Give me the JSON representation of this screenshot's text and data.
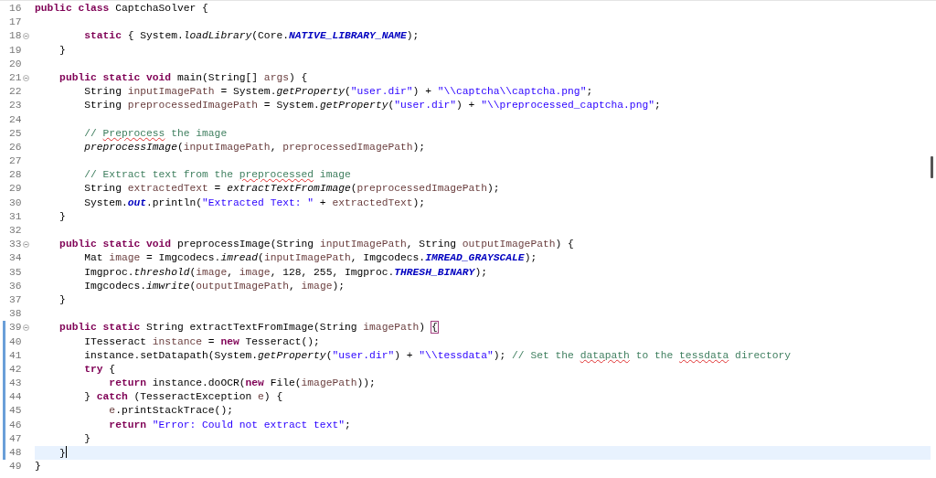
{
  "editor": {
    "lines": [
      {
        "number": "16",
        "tokens": [
          {
            "kind": "keyword",
            "text": "public class "
          },
          {
            "kind": "plain",
            "text": "CaptchaSolver {"
          }
        ]
      },
      {
        "number": "17"
      },
      {
        "number": "18",
        "fold": true,
        "tokens": [
          {
            "kind": "keyword",
            "text": "        static "
          },
          {
            "kind": "plain",
            "text": "{ System."
          },
          {
            "kind": "static-method",
            "text": "loadLibrary"
          },
          {
            "kind": "plain",
            "text": "(Core."
          },
          {
            "kind": "constant",
            "text": "NATIVE_LIBRARY_NAME"
          },
          {
            "kind": "plain",
            "text": ");"
          }
        ]
      },
      {
        "number": "19",
        "tokens": [
          {
            "kind": "plain",
            "text": "    }"
          }
        ]
      },
      {
        "number": "20"
      },
      {
        "number": "21",
        "fold": true,
        "tokens": [
          {
            "kind": "keyword",
            "text": "    public static void "
          },
          {
            "kind": "plain",
            "text": "main(String[] "
          },
          {
            "kind": "variable",
            "text": "args"
          },
          {
            "kind": "plain",
            "text": ") {"
          }
        ]
      },
      {
        "number": "22",
        "tokens": [
          {
            "kind": "plain",
            "text": "        String "
          },
          {
            "kind": "variable",
            "text": "inputImagePath"
          },
          {
            "kind": "plain",
            "text": " = System."
          },
          {
            "kind": "static-method",
            "text": "getProperty"
          },
          {
            "kind": "plain",
            "text": "("
          },
          {
            "kind": "string",
            "text": "\"user.dir\""
          },
          {
            "kind": "plain",
            "text": ") + "
          },
          {
            "kind": "string",
            "text": "\"\\\\captcha\\\\captcha.png\""
          },
          {
            "kind": "plain",
            "text": ";"
          }
        ]
      },
      {
        "number": "23",
        "tokens": [
          {
            "kind": "plain",
            "text": "        String "
          },
          {
            "kind": "variable",
            "text": "preprocessedImagePath"
          },
          {
            "kind": "plain",
            "text": " = System."
          },
          {
            "kind": "static-method",
            "text": "getProperty"
          },
          {
            "kind": "plain",
            "text": "("
          },
          {
            "kind": "string",
            "text": "\"user.dir\""
          },
          {
            "kind": "plain",
            "text": ") + "
          },
          {
            "kind": "string",
            "text": "\"\\\\preprocessed_captcha.png\""
          },
          {
            "kind": "plain",
            "text": ";"
          }
        ]
      },
      {
        "number": "24"
      },
      {
        "number": "25",
        "tokens": [
          {
            "kind": "comment",
            "text": "        // "
          },
          {
            "kind": "misspelled",
            "text": "Preprocess"
          },
          {
            "kind": "comment",
            "text": " the image"
          }
        ]
      },
      {
        "number": "26",
        "tokens": [
          {
            "kind": "static-method",
            "text": "        preprocessImage"
          },
          {
            "kind": "plain",
            "text": "("
          },
          {
            "kind": "variable",
            "text": "inputImagePath"
          },
          {
            "kind": "plain",
            "text": ", "
          },
          {
            "kind": "variable",
            "text": "preprocessedImagePath"
          },
          {
            "kind": "plain",
            "text": ");"
          }
        ]
      },
      {
        "number": "27"
      },
      {
        "number": "28",
        "tokens": [
          {
            "kind": "comment",
            "text": "        // Extract text from the "
          },
          {
            "kind": "misspelled",
            "text": "preprocessed"
          },
          {
            "kind": "comment",
            "text": " image"
          }
        ]
      },
      {
        "number": "29",
        "tokens": [
          {
            "kind": "plain",
            "text": "        String "
          },
          {
            "kind": "variable",
            "text": "extractedText"
          },
          {
            "kind": "plain",
            "text": " = "
          },
          {
            "kind": "static-method",
            "text": "extractTextFromImage"
          },
          {
            "kind": "plain",
            "text": "("
          },
          {
            "kind": "variable",
            "text": "preprocessedImagePath"
          },
          {
            "kind": "plain",
            "text": ");"
          }
        ]
      },
      {
        "number": "30",
        "tokens": [
          {
            "kind": "plain",
            "text": "        System."
          },
          {
            "kind": "constant",
            "text": "out"
          },
          {
            "kind": "plain",
            "text": ".println("
          },
          {
            "kind": "string",
            "text": "\"Extracted Text: \""
          },
          {
            "kind": "plain",
            "text": " + "
          },
          {
            "kind": "variable",
            "text": "extractedText"
          },
          {
            "kind": "plain",
            "text": ");"
          }
        ]
      },
      {
        "number": "31",
        "tokens": [
          {
            "kind": "plain",
            "text": "    }"
          }
        ]
      },
      {
        "number": "32"
      },
      {
        "number": "33",
        "fold": true,
        "tokens": [
          {
            "kind": "keyword",
            "text": "    public static void "
          },
          {
            "kind": "plain",
            "text": "preprocessImage(String "
          },
          {
            "kind": "variable",
            "text": "inputImagePath"
          },
          {
            "kind": "plain",
            "text": ", String "
          },
          {
            "kind": "variable",
            "text": "outputImagePath"
          },
          {
            "kind": "plain",
            "text": ") {"
          }
        ]
      },
      {
        "number": "34",
        "tokens": [
          {
            "kind": "plain",
            "text": "        Mat "
          },
          {
            "kind": "variable",
            "text": "image"
          },
          {
            "kind": "plain",
            "text": " = Imgcodecs."
          },
          {
            "kind": "static-method",
            "text": "imread"
          },
          {
            "kind": "plain",
            "text": "("
          },
          {
            "kind": "variable",
            "text": "inputImagePath"
          },
          {
            "kind": "plain",
            "text": ", Imgcodecs."
          },
          {
            "kind": "constant",
            "text": "IMREAD_GRAYSCALE"
          },
          {
            "kind": "plain",
            "text": ");"
          }
        ]
      },
      {
        "number": "35",
        "tokens": [
          {
            "kind": "plain",
            "text": "        Imgproc."
          },
          {
            "kind": "static-method",
            "text": "threshold"
          },
          {
            "kind": "plain",
            "text": "("
          },
          {
            "kind": "variable",
            "text": "image"
          },
          {
            "kind": "plain",
            "text": ", "
          },
          {
            "kind": "variable",
            "text": "image"
          },
          {
            "kind": "plain",
            "text": ", 128, 255, Imgproc."
          },
          {
            "kind": "constant",
            "text": "THRESH_BINARY"
          },
          {
            "kind": "plain",
            "text": ");"
          }
        ]
      },
      {
        "number": "36",
        "tokens": [
          {
            "kind": "plain",
            "text": "        Imgcodecs."
          },
          {
            "kind": "static-method",
            "text": "imwrite"
          },
          {
            "kind": "plain",
            "text": "("
          },
          {
            "kind": "variable",
            "text": "outputImagePath"
          },
          {
            "kind": "plain",
            "text": ", "
          },
          {
            "kind": "variable",
            "text": "image"
          },
          {
            "kind": "plain",
            "text": ");"
          }
        ]
      },
      {
        "number": "37",
        "tokens": [
          {
            "kind": "plain",
            "text": "    }"
          }
        ]
      },
      {
        "number": "38"
      },
      {
        "number": "39",
        "fold": true,
        "changed": true,
        "tokens": [
          {
            "kind": "keyword",
            "text": "    public static "
          },
          {
            "kind": "plain",
            "text": "String extractTextFromImage(String "
          },
          {
            "kind": "variable",
            "text": "imagePath"
          },
          {
            "kind": "plain",
            "text": ") "
          },
          {
            "kind": "bracket-match",
            "text": "{"
          }
        ]
      },
      {
        "number": "40",
        "changed": true,
        "tokens": [
          {
            "kind": "plain",
            "text": "        ITesseract "
          },
          {
            "kind": "variable",
            "text": "instance"
          },
          {
            "kind": "plain",
            "text": " = "
          },
          {
            "kind": "keyword",
            "text": "new "
          },
          {
            "kind": "plain",
            "text": "Tesseract();"
          }
        ]
      },
      {
        "number": "41",
        "changed": true,
        "tokens": [
          {
            "kind": "plain",
            "text": "        instance.setDatapath(System."
          },
          {
            "kind": "static-method",
            "text": "getProperty"
          },
          {
            "kind": "plain",
            "text": "("
          },
          {
            "kind": "string",
            "text": "\"user.dir\""
          },
          {
            "kind": "plain",
            "text": ") + "
          },
          {
            "kind": "string",
            "text": "\"\\\\tessdata\""
          },
          {
            "kind": "plain",
            "text": "); "
          },
          {
            "kind": "comment",
            "text": "// Set the "
          },
          {
            "kind": "misspelled",
            "text": "datapath"
          },
          {
            "kind": "comment",
            "text": " to the "
          },
          {
            "kind": "misspelled",
            "text": "tessdata"
          },
          {
            "kind": "comment",
            "text": " directory"
          }
        ]
      },
      {
        "number": "42",
        "changed": true,
        "tokens": [
          {
            "kind": "keyword",
            "text": "        try "
          },
          {
            "kind": "plain",
            "text": "{"
          }
        ]
      },
      {
        "number": "43",
        "changed": true,
        "tokens": [
          {
            "kind": "keyword",
            "text": "            return "
          },
          {
            "kind": "plain",
            "text": "instance.doOCR("
          },
          {
            "kind": "keyword",
            "text": "new "
          },
          {
            "kind": "plain",
            "text": "File("
          },
          {
            "kind": "variable",
            "text": "imagePath"
          },
          {
            "kind": "plain",
            "text": "));"
          }
        ]
      },
      {
        "number": "44",
        "changed": true,
        "tokens": [
          {
            "kind": "plain",
            "text": "        } "
          },
          {
            "kind": "keyword",
            "text": "catch "
          },
          {
            "kind": "plain",
            "text": "(TesseractException "
          },
          {
            "kind": "variable",
            "text": "e"
          },
          {
            "kind": "plain",
            "text": ") {"
          }
        ]
      },
      {
        "number": "45",
        "changed": true,
        "tokens": [
          {
            "kind": "variable",
            "text": "            e"
          },
          {
            "kind": "plain",
            "text": ".printStackTrace();"
          }
        ]
      },
      {
        "number": "46",
        "changed": true,
        "tokens": [
          {
            "kind": "keyword",
            "text": "            return "
          },
          {
            "kind": "string",
            "text": "\"Error: Could not extract text\""
          },
          {
            "kind": "plain",
            "text": ";"
          }
        ]
      },
      {
        "number": "47",
        "changed": true,
        "tokens": [
          {
            "kind": "plain",
            "text": "        }"
          }
        ]
      },
      {
        "number": "48",
        "changed": true,
        "current": true,
        "caret": true,
        "tokens": [
          {
            "kind": "plain",
            "text": "    }"
          }
        ]
      },
      {
        "number": "49",
        "tokens": [
          {
            "kind": "plain",
            "text": "}"
          }
        ]
      }
    ]
  }
}
